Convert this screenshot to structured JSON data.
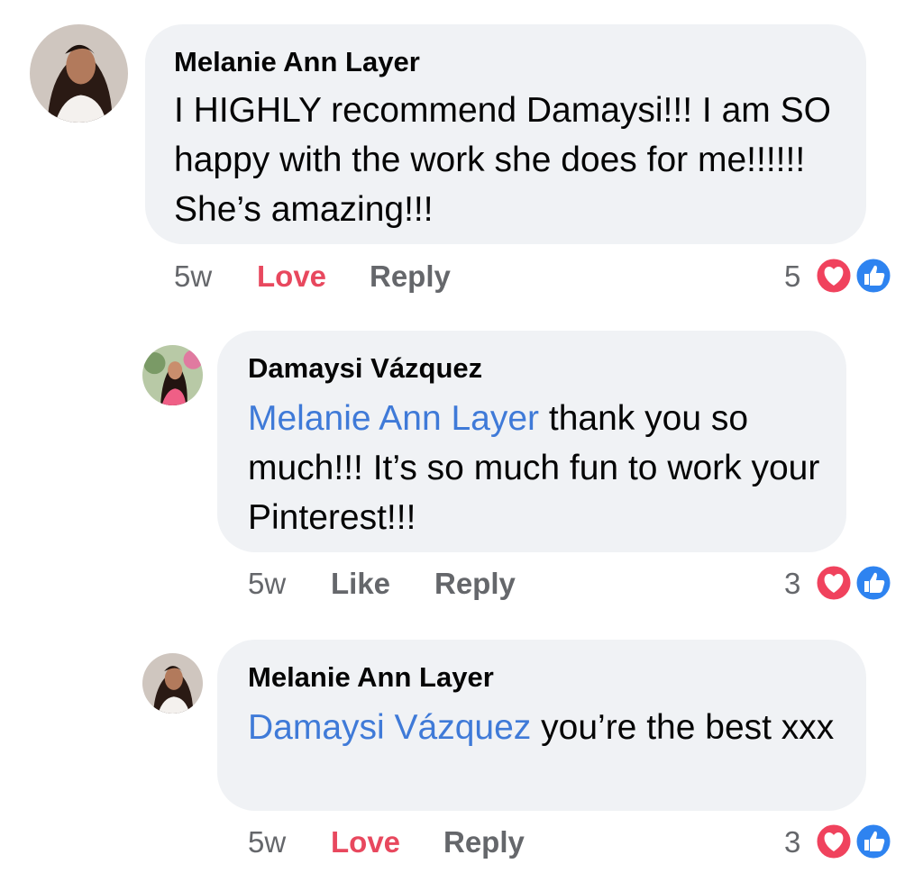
{
  "colors": {
    "bubble": "#f0f2f5",
    "mention": "#3f7ad8",
    "love_action": "#e8485e",
    "muted": "#65676b",
    "like_icon": "#2e83f0",
    "heart_icon": "#f0425d"
  },
  "comments": [
    {
      "author": "Melanie Ann Layer",
      "mention": "",
      "text": "I HIGHLY recommend Damaysi!!! I am SO happy with the work she does for me!!!!!! She’s amazing!!!",
      "time": "5w",
      "reaction_action": "Love",
      "reply_label": "Reply",
      "reaction_count": "5",
      "reaction_icons": [
        "heart-icon",
        "like-icon"
      ]
    },
    {
      "author": "Damaysi Vázquez",
      "mention": "Melanie Ann Layer",
      "text": " thank you so much!!! It’s so much fun to work your Pinterest!!!",
      "time": "5w",
      "reaction_action": "Like",
      "reply_label": "Reply",
      "reaction_count": "3",
      "reaction_icons": [
        "heart-icon",
        "like-icon"
      ]
    },
    {
      "author": "Melanie Ann Layer",
      "mention": "Damaysi Vázquez",
      "text": " you’re the best xxx",
      "time": "5w",
      "reaction_action": "Love",
      "reply_label": "Reply",
      "reaction_count": "3",
      "reaction_icons": [
        "heart-icon",
        "like-icon"
      ]
    }
  ]
}
